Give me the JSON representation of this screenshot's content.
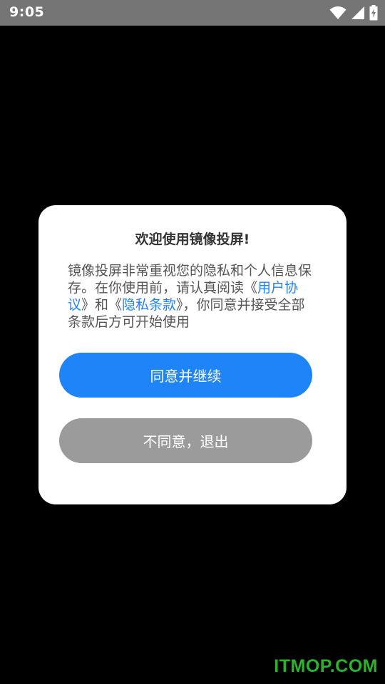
{
  "status_bar": {
    "time": "9:05",
    "icons": [
      "wifi-icon",
      "cell-signal-icon",
      "battery-charging-icon"
    ],
    "background": "#757575"
  },
  "dialog": {
    "title": "欢迎使用镜像投屏!",
    "message": {
      "part1": "镜像投屏非常重视您的隐私和个人信息保存。在你使用前，请认真阅读《",
      "link_user_agreement": "用户协议",
      "part2": "》和《",
      "link_privacy_terms": "隐私条款",
      "part3": "》，你同意并接受全部条款后方可开始使用"
    },
    "agree_button": "同意并继续",
    "disagree_button": "不同意，退出"
  },
  "colors": {
    "link": "#2181f5",
    "agree_button": "#1e84f8",
    "disagree_button": "#9b9b9b",
    "watermark": "#2bb32b"
  },
  "watermark": {
    "text": "ITMOP.COM"
  }
}
